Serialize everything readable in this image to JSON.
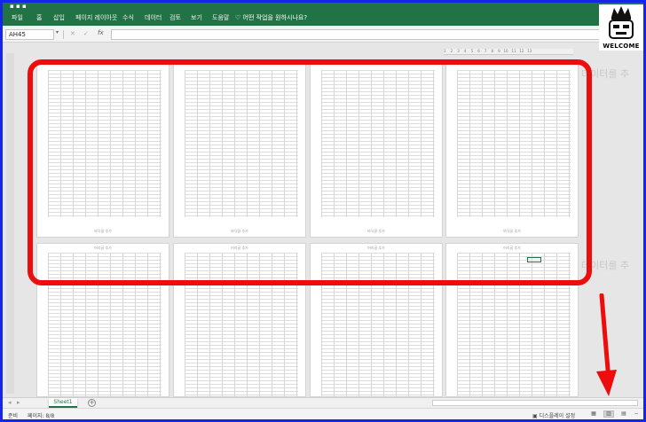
{
  "ribbon": {
    "tabs": [
      "파일",
      "홈",
      "삽입",
      "페이지 레이아웃",
      "수식",
      "데이터",
      "검토",
      "보기",
      "도움말"
    ],
    "tell_me": "어떤 작업을 원하시나요?"
  },
  "formula_bar": {
    "name_box": "AH45",
    "cancel_icon": "close-icon",
    "enter_icon": "check-icon",
    "fx_label": "fx",
    "value": ""
  },
  "pages": {
    "footer_label": "바닥글 추가",
    "header_label": "머리글 추가",
    "add_data_hint": "데이터를 추"
  },
  "column_ruler": [
    "1",
    "2",
    "3",
    "4",
    "5",
    "6",
    "7",
    "8",
    "9",
    "10",
    "11",
    "12",
    "13"
  ],
  "sheet_tabs": {
    "active": "Sheet1",
    "add_label": "+"
  },
  "status_bar": {
    "ready": "준비",
    "page": "페이지: 8/8",
    "display_settings": "디스플레이 설정"
  },
  "logo": {
    "text": "WELCOME"
  },
  "annotation": {
    "highlight_color": "#ee0d0d",
    "arrow_color": "#ee0d0d",
    "frame_color": "#1626e8"
  },
  "colors": {
    "excel_green": "#217346"
  }
}
